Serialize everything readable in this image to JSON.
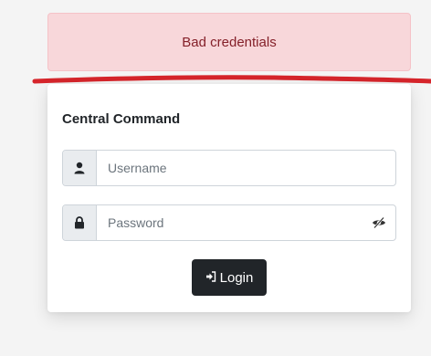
{
  "alert": {
    "message": "Bad credentials",
    "color": "#f8d7da"
  },
  "form": {
    "title": "Central Command",
    "username": {
      "placeholder": "Username",
      "value": "",
      "icon": "user-icon"
    },
    "password": {
      "placeholder": "Password",
      "value": "",
      "icon": "lock-icon",
      "toggle_icon": "eye-slash-icon"
    },
    "submit": {
      "label": "Login",
      "icon": "sign-in-icon",
      "color": "#212529"
    }
  },
  "annotation": {
    "color": "#d6252b"
  }
}
